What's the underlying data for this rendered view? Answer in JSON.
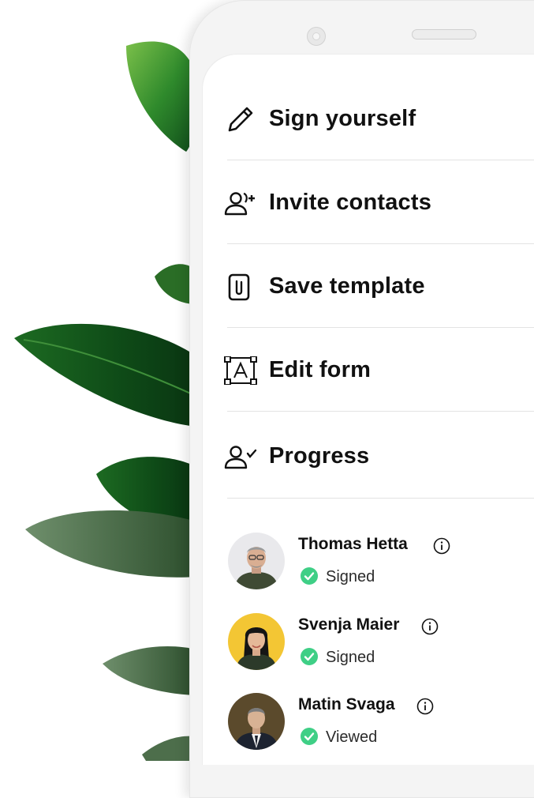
{
  "menu": {
    "items": [
      {
        "label": "Sign yourself",
        "icon": "pen-icon"
      },
      {
        "label": "Invite contacts",
        "icon": "user-plus-icon"
      },
      {
        "label": "Save template",
        "icon": "paperclip-document-icon"
      },
      {
        "label": "Edit form",
        "icon": "text-field-frame-icon"
      },
      {
        "label": "Progress",
        "icon": "user-check-icon"
      }
    ]
  },
  "signers": [
    {
      "name": "Thomas Hetta",
      "status": "Signed",
      "avatar_bg": "#e9e9ec"
    },
    {
      "name": "Svenja Maier",
      "status": "Signed",
      "avatar_bg": "#f3c634"
    },
    {
      "name": "Matin Svaga",
      "status": "Viewed",
      "avatar_bg": "#5b4a2c"
    }
  ],
  "colors": {
    "status_green": "#3fcf86",
    "text_dark": "#111111",
    "leaf_green": "#2e7d32"
  }
}
